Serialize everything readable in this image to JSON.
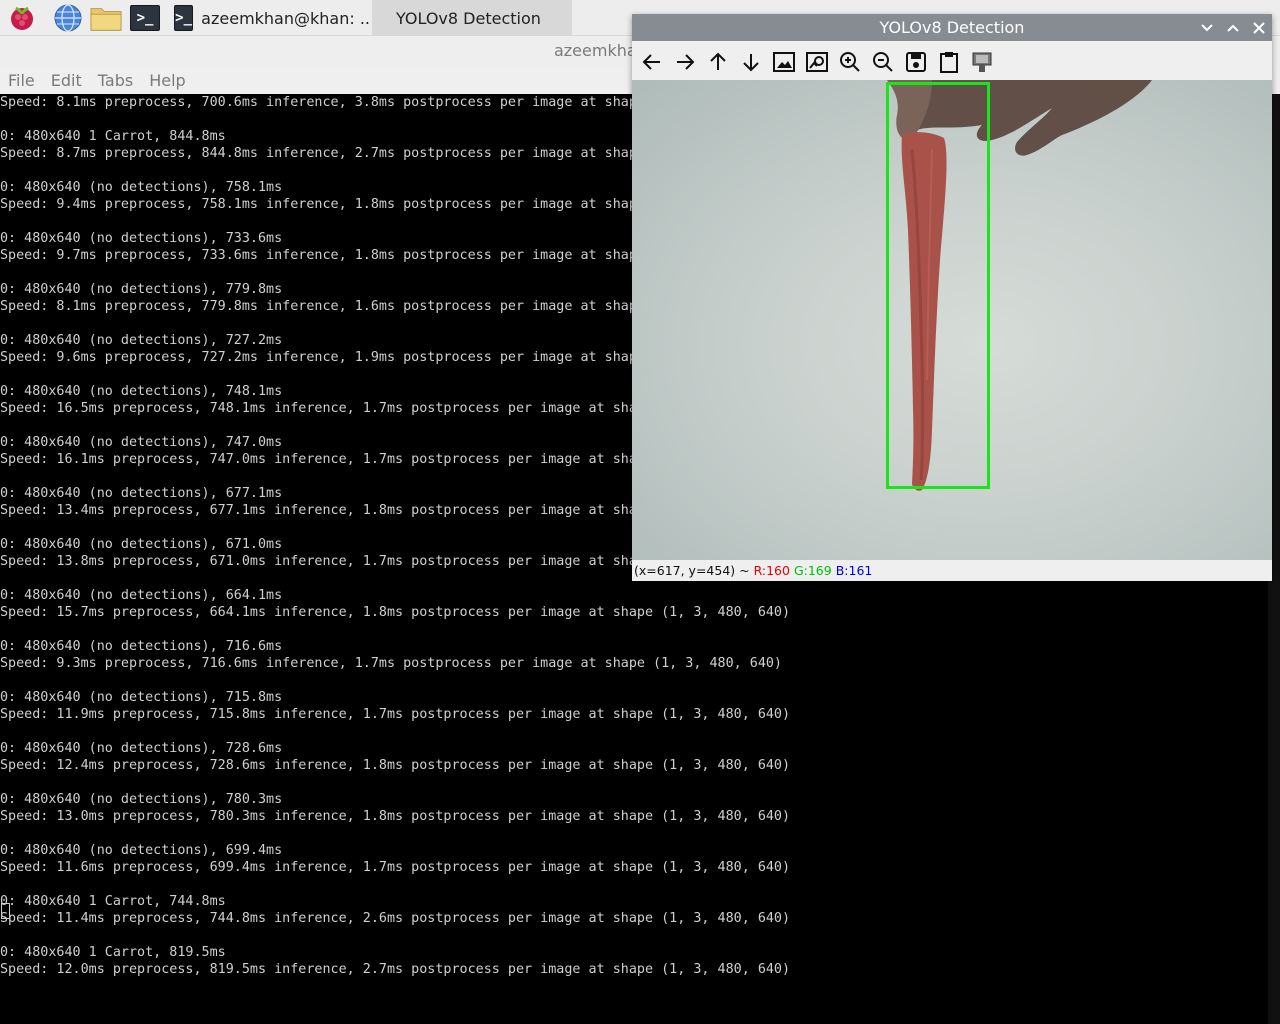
{
  "taskbar": {
    "task1_title": "azeemkhan@khan: ..",
    "task2_title": "YOLOv8 Detection",
    "icons": [
      "raspberry-menu-icon",
      "web-browser-icon",
      "file-manager-icon",
      "terminal-icon"
    ]
  },
  "terminal": {
    "title": "azeemkhan@khan: ~",
    "menu": [
      "File",
      "Edit",
      "Tabs",
      "Help"
    ],
    "lines": [
      "Speed: 8.1ms preprocess, 700.6ms inference, 3.8ms postprocess per image at shape (1, 3, 480, 640)",
      "",
      "0: 480x640 1 Carrot, 844.8ms",
      "Speed: 8.7ms preprocess, 844.8ms inference, 2.7ms postprocess per image at shape (1, 3, 480, 640)",
      "",
      "0: 480x640 (no detections), 758.1ms",
      "Speed: 9.4ms preprocess, 758.1ms inference, 1.8ms postprocess per image at shape (1, 3, 480, 640)",
      "",
      "0: 480x640 (no detections), 733.6ms",
      "Speed: 9.7ms preprocess, 733.6ms inference, 1.8ms postprocess per image at shape (1, 3, 480, 640)",
      "",
      "0: 480x640 (no detections), 779.8ms",
      "Speed: 8.1ms preprocess, 779.8ms inference, 1.6ms postprocess per image at shape (1, 3, 480, 640)",
      "",
      "0: 480x640 (no detections), 727.2ms",
      "Speed: 9.6ms preprocess, 727.2ms inference, 1.9ms postprocess per image at shape (1, 3, 480, 640)",
      "",
      "0: 480x640 (no detections), 748.1ms",
      "Speed: 16.5ms preprocess, 748.1ms inference, 1.7ms postprocess per image at shape (1, 3, 480, 640)",
      "",
      "0: 480x640 (no detections), 747.0ms",
      "Speed: 16.1ms preprocess, 747.0ms inference, 1.7ms postprocess per image at shape (1, 3, 480, 640)",
      "",
      "0: 480x640 (no detections), 677.1ms",
      "Speed: 13.4ms preprocess, 677.1ms inference, 1.8ms postprocess per image at shape (1, 3, 480, 640)",
      "",
      "0: 480x640 (no detections), 671.0ms",
      "Speed: 13.8ms preprocess, 671.0ms inference, 1.7ms postprocess per image at shape (1, 3, 480, 640)",
      "",
      "0: 480x640 (no detections), 664.1ms",
      "Speed: 15.7ms preprocess, 664.1ms inference, 1.8ms postprocess per image at shape (1, 3, 480, 640)",
      "",
      "0: 480x640 (no detections), 716.6ms",
      "Speed: 9.3ms preprocess, 716.6ms inference, 1.7ms postprocess per image at shape (1, 3, 480, 640)",
      "",
      "0: 480x640 (no detections), 715.8ms",
      "Speed: 11.9ms preprocess, 715.8ms inference, 1.7ms postprocess per image at shape (1, 3, 480, 640)",
      "",
      "0: 480x640 (no detections), 728.6ms",
      "Speed: 12.4ms preprocess, 728.6ms inference, 1.8ms postprocess per image at shape (1, 3, 480, 640)",
      "",
      "0: 480x640 (no detections), 780.3ms",
      "Speed: 13.0ms preprocess, 780.3ms inference, 1.8ms postprocess per image at shape (1, 3, 480, 640)",
      "",
      "0: 480x640 (no detections), 699.4ms",
      "Speed: 11.6ms preprocess, 699.4ms inference, 1.7ms postprocess per image at shape (1, 3, 480, 640)",
      "",
      "0: 480x640 1 Carrot, 744.8ms",
      "Speed: 11.4ms preprocess, 744.8ms inference, 2.6ms postprocess per image at shape (1, 3, 480, 640)",
      "",
      "0: 480x640 1 Carrot, 819.5ms",
      "Speed: 12.0ms preprocess, 819.5ms inference, 2.7ms postprocess per image at shape (1, 3, 480, 640)"
    ]
  },
  "cv_window": {
    "title": "YOLOv8 Detection",
    "toolbar": [
      "pan-left-icon",
      "pan-right-icon",
      "pan-up-icon",
      "pan-down-icon",
      "zoom-original-icon",
      "zoom-fit-icon",
      "zoom-in-icon",
      "zoom-out-icon",
      "save-image-icon",
      "copy-clipboard-icon",
      "properties-icon"
    ],
    "status": {
      "coords": "(x=617, y=454) ~",
      "r": "R:160",
      "g": "G:169",
      "b": "B:161"
    },
    "colors": {
      "box": "#19e619",
      "r": "#e60000",
      "g": "#00c000",
      "b": "#0000e6"
    }
  }
}
